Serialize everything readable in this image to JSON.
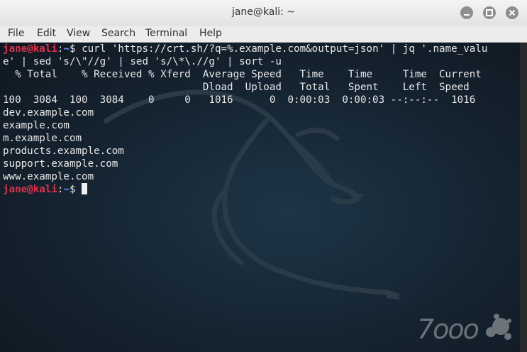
{
  "window": {
    "title": "jane@kali: ~"
  },
  "menu": [
    "File",
    "Edit",
    "View",
    "Search",
    "Terminal",
    "Help"
  ],
  "prompt": {
    "user": "jane",
    "at": "@",
    "host": "kali",
    "sep": ":",
    "path": "~",
    "symbol": "$"
  },
  "command": {
    "line1": " curl 'https://crt.sh/?q=%.example.com&output=json' | jq '.name_valu",
    "line2": "e' | sed 's/\\\"//g' | sed 's/\\*\\.//g' | sort -u"
  },
  "curl_progress": {
    "header1": "  % Total    % Received % Xferd  Average Speed   Time    Time     Time  Current",
    "header2": "                                 Dload  Upload   Total   Spent    Left  Speed",
    "row": "100  3084  100  3084    0     0   1016      0  0:00:03  0:00:03 --:--:--  1016"
  },
  "results": [
    "dev.example.com",
    "example.com",
    "m.example.com",
    "products.example.com",
    "support.example.com",
    "www.example.com"
  ],
  "watermark": {
    "text": "7ooo"
  },
  "colors": {
    "terminal_bg": "#152330",
    "prompt_user": "#e0304a",
    "prompt_path": "#6a8fff",
    "text": "#e8e8e8"
  }
}
